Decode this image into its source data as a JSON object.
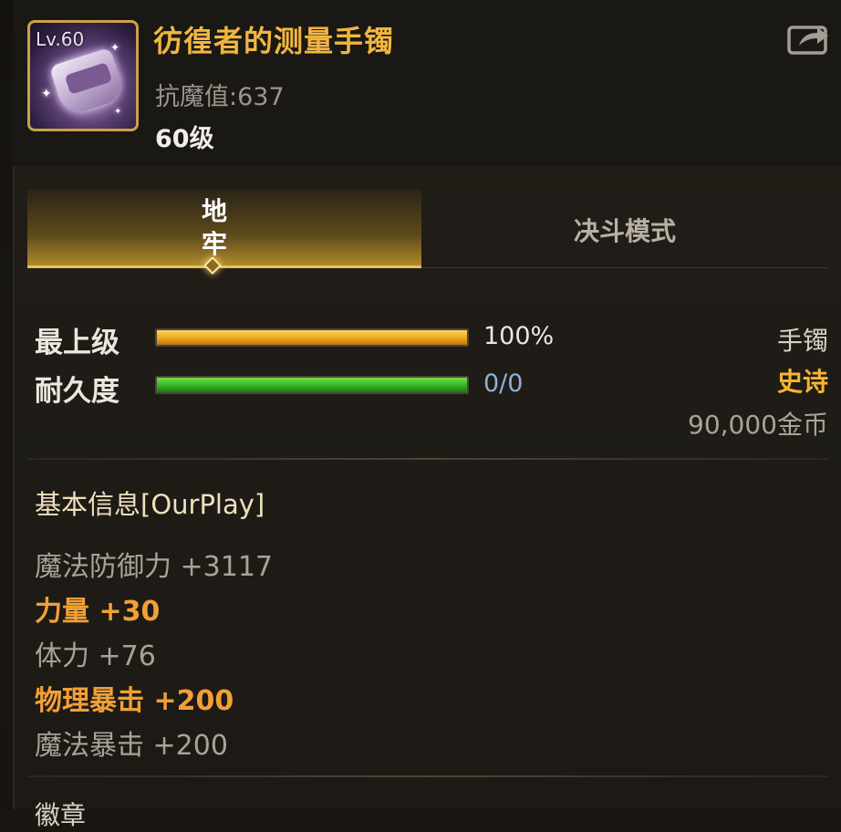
{
  "item": {
    "icon_level": "Lv.60",
    "name": "彷徨者的测量手镯",
    "magic_resist": "抗魔值:637",
    "level": "60级",
    "icon": "bracelet-icon"
  },
  "tabs": [
    {
      "label": "地牢",
      "active": true
    },
    {
      "label": "决斗模式",
      "active": false
    }
  ],
  "stats_bars": {
    "max_level_label": "最上级",
    "max_level_value": "100%",
    "max_level_fraction": 1.0,
    "durability_label": "耐久度",
    "durability_value": "0/0",
    "durability_fraction": 1.0
  },
  "item_info": {
    "type": "手镯",
    "rarity": "史诗",
    "price": "90,000金币"
  },
  "basic_info": {
    "title": "基本信息[OurPlay]",
    "stats": [
      {
        "text": "魔法防御力 +3117",
        "highlight": false
      },
      {
        "text": "力量 +30",
        "highlight": true
      },
      {
        "text": "体力 +76",
        "highlight": false
      },
      {
        "text": "物理暴击 +200",
        "highlight": true
      },
      {
        "text": "魔法暴击 +200",
        "highlight": false
      }
    ]
  },
  "next_section_title": "徽章",
  "colors": {
    "item_name": "#f1b640",
    "rarity": "#f6b52e",
    "highlight_stat": "#f1a037",
    "bar_gold": "#e8a21a",
    "bar_green": "#2fae1c"
  },
  "share_icon": "share-icon"
}
